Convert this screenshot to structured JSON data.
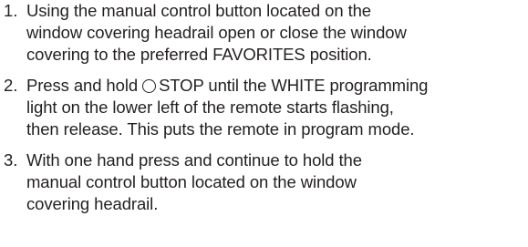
{
  "steps": [
    {
      "number": "1.",
      "lines": [
        "Using the manual control button located on the",
        "window covering headrail open or close the window",
        "covering to the preferred FAVORITES position."
      ]
    },
    {
      "number": "2.",
      "line1_pre": "Press and hold",
      "icon": "circle-stop-icon",
      "line1_post": "STOP until the WHITE programming",
      "lines": [
        "light on the lower left of the remote starts flashing,",
        "then release. This puts the remote in program mode."
      ]
    },
    {
      "number": "3.",
      "lines": [
        "With one hand press and continue to hold the",
        "manual control button located on the window",
        "covering headrail."
      ]
    }
  ]
}
